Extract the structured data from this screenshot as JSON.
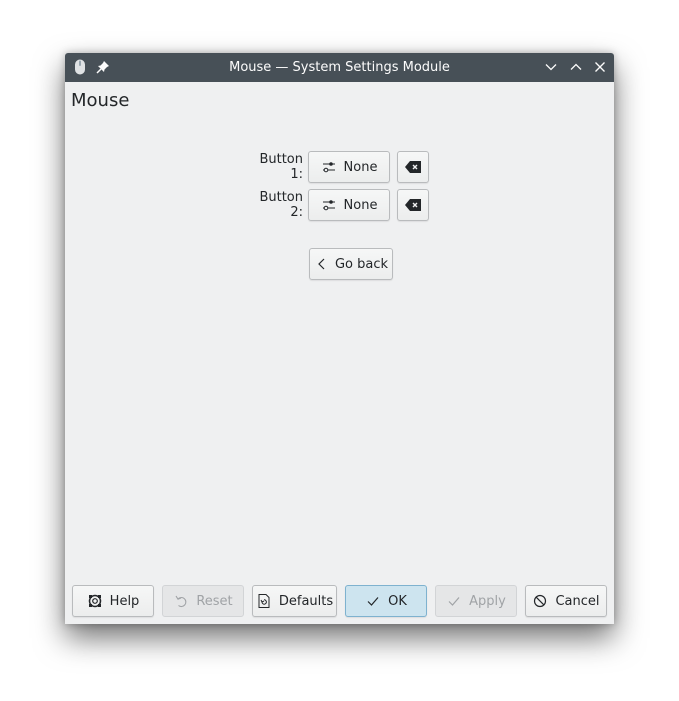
{
  "window": {
    "title": "Mouse — System Settings Module",
    "app_icon": "mouse-icon",
    "pin_icon": "pin-icon",
    "controls": {
      "minimize": "chevron-down-icon",
      "maximize": "chevron-up-icon",
      "close": "close-icon"
    }
  },
  "page": {
    "title": "Mouse"
  },
  "bindings": [
    {
      "label": "Button 1:",
      "value": "None",
      "icon": "configure-icon",
      "clear_icon": "backspace-clear-icon"
    },
    {
      "label": "Button 2:",
      "value": "None",
      "icon": "configure-icon",
      "clear_icon": "backspace-clear-icon"
    }
  ],
  "go_back": {
    "label": "Go back",
    "icon": "chevron-left-icon"
  },
  "footer": {
    "help": {
      "label": "Help",
      "icon": "help-lifebuoy-icon",
      "enabled": true
    },
    "reset": {
      "label": "Reset",
      "icon": "undo-icon",
      "enabled": false
    },
    "defaults": {
      "label": "Defaults",
      "icon": "document-revert-icon",
      "enabled": true
    },
    "ok": {
      "label": "OK",
      "icon": "checkmark-icon",
      "enabled": true,
      "default": true
    },
    "apply": {
      "label": "Apply",
      "icon": "checkmark-icon",
      "enabled": false
    },
    "cancel": {
      "label": "Cancel",
      "icon": "cancel-icon",
      "enabled": true
    }
  },
  "colors": {
    "titlebar": "#475057",
    "window_bg": "#eff0f1",
    "primary_button_bg": "#cde4ef",
    "primary_button_border": "#7eb2cf",
    "text": "#232629",
    "disabled_text": "#a0a3a6"
  }
}
